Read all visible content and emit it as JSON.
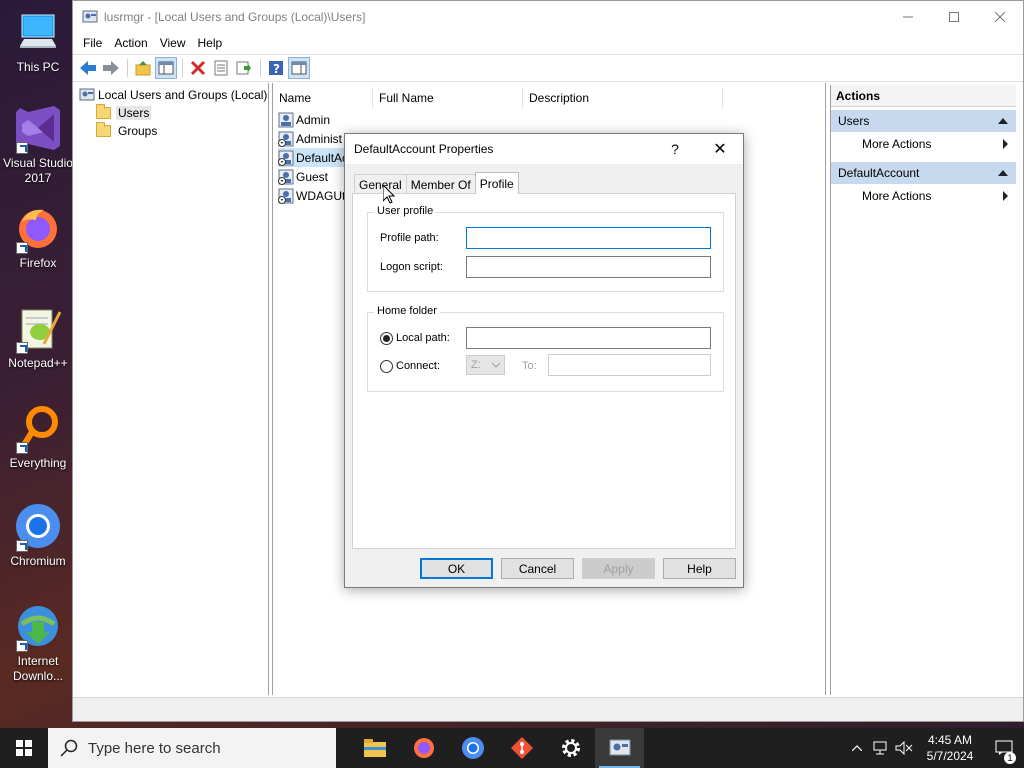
{
  "desktop": {
    "icons": [
      {
        "label": "This PC",
        "icon": "this-pc-icon"
      },
      {
        "label": "Visual Studio 2017",
        "icon": "visual-studio-icon"
      },
      {
        "label": "Firefox",
        "icon": "firefox-icon"
      },
      {
        "label": "Notepad++",
        "icon": "notepadpp-icon"
      },
      {
        "label": "Everything",
        "icon": "everything-icon"
      },
      {
        "label": "Chromium",
        "icon": "chromium-icon"
      },
      {
        "label": "Internet Downlo...",
        "icon": "internet-download-manager-icon"
      }
    ]
  },
  "window": {
    "title": "lusrmgr - [Local Users and Groups (Local)\\Users]",
    "menu": [
      "File",
      "Action",
      "View",
      "Help"
    ],
    "toolbar_icons": [
      "back-icon",
      "forward-icon",
      "up-folder-icon",
      "show-hide-tree-icon",
      "delete-icon",
      "properties-icon",
      "export-icon",
      "help-icon",
      "show-hide-action-pane-icon"
    ]
  },
  "tree": {
    "root": "Local Users and Groups (Local)",
    "children": [
      "Users",
      "Groups"
    ],
    "selected": "Users"
  },
  "list": {
    "columns": [
      "Name",
      "Full Name",
      "Description"
    ],
    "rows": [
      {
        "name": "Admin"
      },
      {
        "name": "Administ"
      },
      {
        "name": "DefaultAc"
      },
      {
        "name": "Guest"
      },
      {
        "name": "WDAGUti"
      }
    ]
  },
  "actions": {
    "header": "Actions",
    "sections": [
      {
        "title": "Users",
        "items": [
          "More Actions"
        ]
      },
      {
        "title": "DefaultAccount",
        "items": [
          "More Actions"
        ]
      }
    ]
  },
  "dialog": {
    "title": "DefaultAccount Properties",
    "help_glyph": "?",
    "close_glyph": "✕",
    "tabs": [
      "General",
      "Member Of",
      "Profile"
    ],
    "active_tab": "Profile",
    "user_profile": {
      "group_label": "User profile",
      "profile_path_label": "Profile path:",
      "profile_path_value": "",
      "logon_script_label": "Logon script:",
      "logon_script_value": ""
    },
    "home_folder": {
      "group_label": "Home folder",
      "local_path_label": "Local path:",
      "local_path_value": "",
      "connect_label": "Connect:",
      "drive_value": "Z:",
      "to_label": "To:",
      "to_value": ""
    },
    "buttons": {
      "ok": "OK",
      "cancel": "Cancel",
      "apply": "Apply",
      "help": "Help"
    }
  },
  "taskbar": {
    "search_placeholder": "Type here to search",
    "apps": [
      "file-explorer-icon",
      "firefox-icon",
      "chromium-icon",
      "git-icon",
      "settings-gear-icon",
      "lusrmgr-icon"
    ],
    "clock_time": "4:45 AM",
    "clock_date": "5/7/2024",
    "notification_count": "1"
  },
  "colors": {
    "accent": "#0078d7",
    "actions_section": "#c6d9ee",
    "taskbar": "#1f1f1f"
  }
}
